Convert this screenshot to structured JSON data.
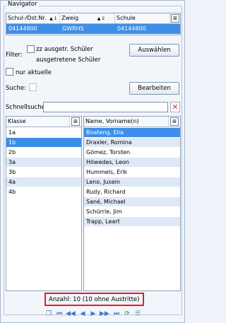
{
  "navigator": {
    "title": "Navigator",
    "columns": [
      "Schul-/Dst.Nr.",
      "Zweig",
      "Schule"
    ],
    "sort_marks": [
      "1",
      "2"
    ],
    "row": [
      "04144800",
      "GWRHS",
      "04144800"
    ]
  },
  "filter": {
    "label": "Filter:",
    "option1_line1": "zz ausgetr. Schüler",
    "option1_line2": "ausgetretene Schüler",
    "select_button": "Auswählen",
    "only_current": "nur aktuelle"
  },
  "search": {
    "label": "Suche:",
    "edit_button": "Bearbeiten",
    "quick_search_label": "Schnellsuche",
    "quick_search_value": ""
  },
  "class_list": {
    "header": "Klasse",
    "items": [
      "1a",
      "1b",
      "2b",
      "3a",
      "3b",
      "4a",
      "4b"
    ],
    "selected_index": 1
  },
  "student_list": {
    "header": "Name, Vorname(n)",
    "items": [
      "Boateng, Elia",
      "Draxler, Romina",
      "Gómez, Torsten",
      "Höwedes, Leon",
      "Hummels, Erik",
      "Leno, Jusein",
      "Rudy, Richard",
      "Sané, Michael",
      "Schürrle, Jim",
      "Trapp, Leart"
    ],
    "selected_index": 0
  },
  "footer": {
    "count_text": "Anzahl: 10 (10 ohne Austritte)"
  },
  "colors": {
    "selection": "#3d8ee8",
    "alt_row": "#dfe8f6",
    "highlight_box": "#e02020",
    "clear_icon": "#e03030"
  }
}
